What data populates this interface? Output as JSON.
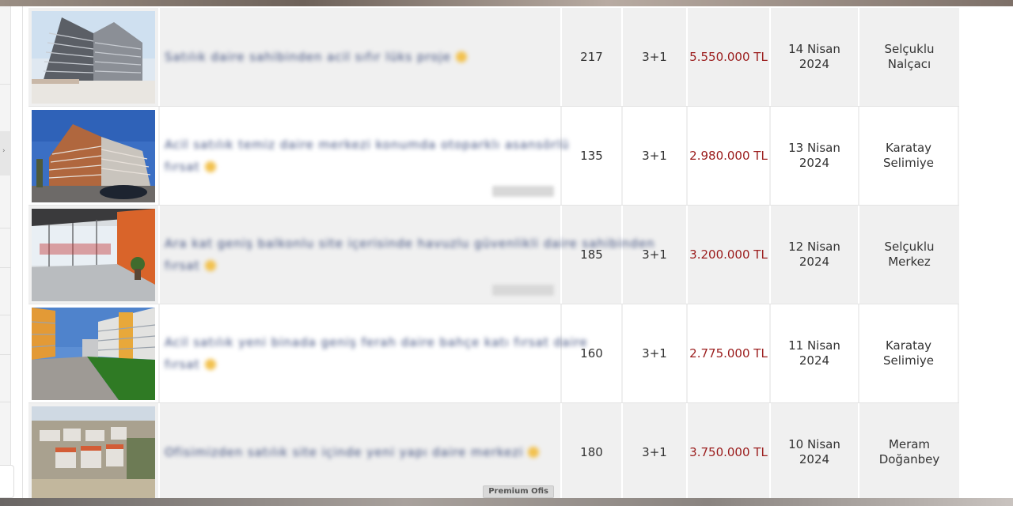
{
  "listings": [
    {
      "title_blurred": "Satılık daire sahibinden acil sıfır lüks proje ",
      "title_blurred_2": "",
      "m2": "217",
      "rooms": "3+1",
      "price": "5.550.000 TL",
      "date_line1": "14 Nisan",
      "date_line2": "2024",
      "loc_line1": "Selçuklu",
      "loc_line2": "Nalçacı",
      "badge": ""
    },
    {
      "title_blurred": "Acil satılık temiz daire merkezi konumda otoparklı asansörlü",
      "title_blurred_2": "fırsat",
      "m2": "135",
      "rooms": "3+1",
      "price": "2.980.000 TL",
      "date_line1": "13 Nisan",
      "date_line2": "2024",
      "loc_line1": "Karatay",
      "loc_line2": "Selimiye",
      "badge": ""
    },
    {
      "title_blurred": "Ara kat geniş balkonlu site içerisinde havuzlu güvenlikli daire sahibinden",
      "title_blurred_2": "fırsat",
      "m2": "185",
      "rooms": "3+1",
      "price": "3.200.000 TL",
      "date_line1": "12 Nisan",
      "date_line2": "2024",
      "loc_line1": "Selçuklu",
      "loc_line2": "Merkez",
      "badge": ""
    },
    {
      "title_blurred": "Acil satılık yeni binada geniş ferah daire bahçe katı fırsat daire",
      "title_blurred_2": "fırsat",
      "m2": "160",
      "rooms": "3+1",
      "price": "2.775.000 TL",
      "date_line1": "11 Nisan",
      "date_line2": "2024",
      "loc_line1": "Karatay",
      "loc_line2": "Selimiye",
      "badge": ""
    },
    {
      "title_blurred": "Ofisimizden satılık site içinde yeni yapı daire merkezi",
      "title_blurred_2": "",
      "m2": "180",
      "rooms": "3+1",
      "price": "3.750.000 TL",
      "date_line1": "10 Nisan",
      "date_line2": "2024",
      "loc_line1": "Meram",
      "loc_line2": "Doğanbey",
      "badge": "Premium Ofis"
    }
  ],
  "colors": {
    "price": "#9b1d1d",
    "row_grey": "#f0f0f0",
    "row_white": "#ffffff"
  },
  "icons": {
    "favorite": "star-icon",
    "sidebar_toggle": "chevron-right-icon"
  }
}
